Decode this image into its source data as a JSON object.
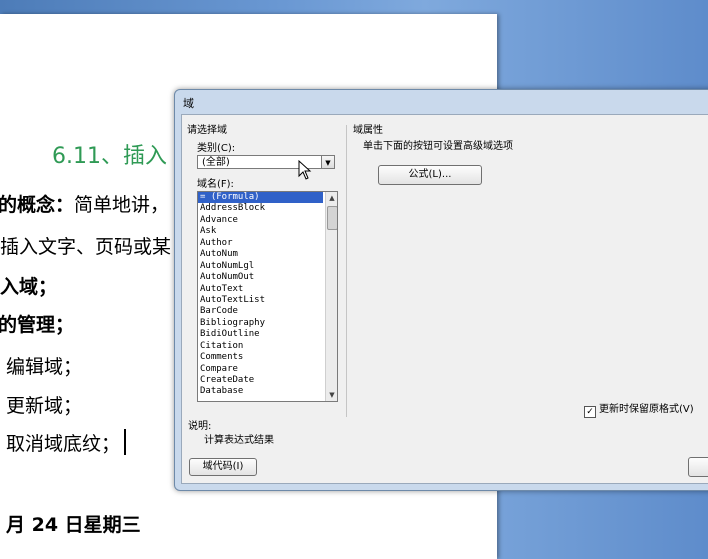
{
  "document": {
    "heading": "6.11、插入",
    "lines": [
      {
        "bold": "的概念：",
        "text": "简单地讲，"
      },
      {
        "bold": "",
        "text": "插入文字、页码或某"
      },
      {
        "bold": "入域；",
        "text": ""
      },
      {
        "bold": "的管理；",
        "text": ""
      },
      {
        "bold": "",
        "text": "编辑域；"
      },
      {
        "bold": "",
        "text": "更新域；"
      },
      {
        "bold": "",
        "text": "取消域底纹；"
      }
    ],
    "date": "月 24 日星期三"
  },
  "dialog": {
    "title": "域",
    "left_group_title": "请选择域",
    "category_label": "类别(C):",
    "category_value": "(全部)",
    "field_names_label": "域名(F):",
    "field_names": [
      "= (Formula)",
      "AddressBlock",
      "Advance",
      "Ask",
      "Author",
      "AutoNum",
      "AutoNumLgl",
      "AutoNumOut",
      "AutoText",
      "AutoTextList",
      "BarCode",
      "Bibliography",
      "BidiOutline",
      "Citation",
      "Comments",
      "Compare",
      "CreateDate",
      "Database"
    ],
    "selected_index": 0,
    "description_label": "说明:",
    "description_text": "计算表达式结果",
    "field_codes_button": "域代码(I)",
    "right_group_title": "域属性",
    "right_hint": "单击下面的按钮可设置高级域选项",
    "formula_button": "公式(L)...",
    "preserve_format_label": "更新时保留原格式(V)",
    "preserve_format_checked": true
  }
}
